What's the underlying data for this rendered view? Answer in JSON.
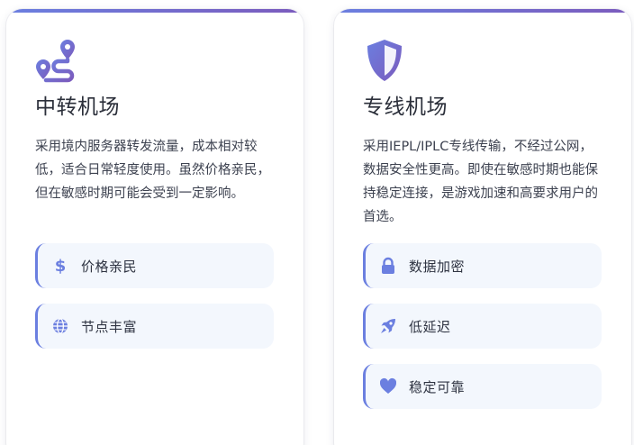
{
  "theme": {
    "accent": "#6b7fe0",
    "accent_end": "#7b5bbd",
    "feature_bg": "#f3f7fd"
  },
  "cards": [
    {
      "icon": "route-icon",
      "title": "中转机场",
      "description": "采用境内服务器转发流量，成本相对较低，适合日常轻度使用。虽然价格亲民，但在敏感时期可能会受到一定影响。",
      "features": [
        {
          "icon": "dollar-icon",
          "label": "价格亲民"
        },
        {
          "icon": "globe-icon",
          "label": "节点丰富"
        }
      ]
    },
    {
      "icon": "shield-icon",
      "title": "专线机场",
      "description": "采用IEPL/IPLC专线传输，不经过公网，数据安全性更高。即使在敏感时期也能保持稳定连接，是游戏加速和高要求用户的首选。",
      "features": [
        {
          "icon": "lock-icon",
          "label": "数据加密"
        },
        {
          "icon": "rocket-icon",
          "label": "低延迟"
        },
        {
          "icon": "heart-icon",
          "label": "稳定可靠"
        }
      ]
    }
  ]
}
